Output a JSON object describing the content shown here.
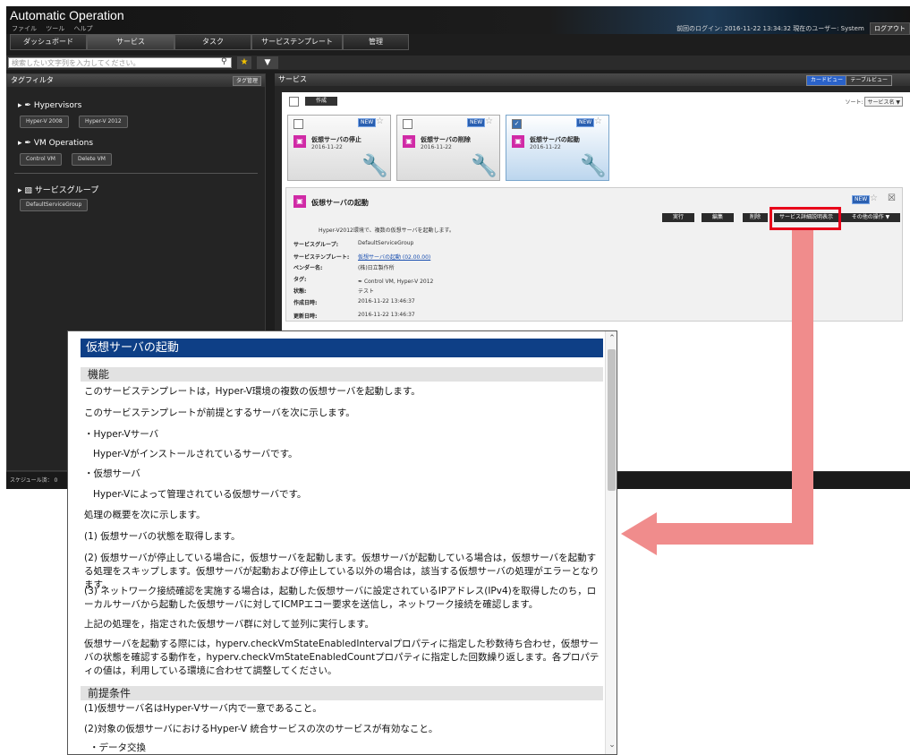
{
  "app": {
    "title": "Automatic Operation",
    "menu": [
      "ファイル",
      "ツール",
      "ヘルプ"
    ],
    "login_info": "前回のログイン: 2016-11-22 13:34:32  現在のユーザー: System",
    "logout_label": "ログアウト"
  },
  "tabs": [
    "ダッシュボード",
    "サービス",
    "タスク",
    "サービステンプレート",
    "管理"
  ],
  "search": {
    "placeholder": "検索したい文字列を入力してください。"
  },
  "left_panel": {
    "title": "タグフィルタ",
    "tag_manage_label": "タグ管理",
    "groups": [
      {
        "name": "Hypervisors",
        "tags": [
          "Hyper-V 2008",
          "Hyper-V 2012"
        ]
      },
      {
        "name": "VM Operations",
        "tags": [
          "Control VM",
          "Delete VM"
        ]
      }
    ],
    "service_group": {
      "name": "サービスグループ",
      "items": [
        "DefaultServiceGroup"
      ]
    }
  },
  "status_bar": {
    "text": "スケジュール済： 0"
  },
  "right_panel": {
    "title": "サービス",
    "card_view_label": "カードビュー",
    "table_view_label": "テーブルビュー",
    "create_label": "作成",
    "sort_label": "ソート:",
    "sort_value": "サービス名",
    "cards": [
      {
        "name": "仮想サーバの停止",
        "date": "2016-11-22",
        "badge": "NEW",
        "selected": false
      },
      {
        "name": "仮想サーバの削除",
        "date": "2016-11-22",
        "badge": "NEW",
        "selected": false
      },
      {
        "name": "仮想サーバの起動",
        "date": "2016-11-22",
        "badge": "NEW",
        "selected": true
      }
    ]
  },
  "detail": {
    "title": "仮想サーバの起動",
    "badge": "NEW",
    "actions": [
      "実行",
      "編集",
      "削除",
      "サービス詳細説明表示",
      "その他の操作"
    ],
    "description": "Hyper-V2012環境で、複数の仮想サーバを起動します。",
    "props": [
      {
        "label": "サービスグループ:",
        "value": "DefaultServiceGroup"
      },
      {
        "label": "サービステンプレート:",
        "value": "仮想サーバの起動 (02.00.00)"
      },
      {
        "label": "ベンダー名:",
        "value": "(株)日立製作所"
      },
      {
        "label": "タグ:",
        "value": "Control VM, Hyper-V 2012"
      },
      {
        "label": "状態:",
        "value": "テスト"
      },
      {
        "label": "作成日時:",
        "value": "2016-11-22 13:46:37"
      },
      {
        "label": "更新日時:",
        "value": "2016-11-22 13:46:37"
      }
    ]
  },
  "popup": {
    "title": "仮想サーバの起動",
    "section_function": "機能",
    "section_prereq": "前提条件",
    "lines": [
      "このサービステンプレートは，Hyper-V環境の複数の仮想サーバを起動します。",
      "このサービステンプレートが前提とするサーバを次に示します。",
      "・Hyper-Vサーバ",
      "Hyper-Vがインストールされているサーバです。",
      "・仮想サーバ",
      "Hyper-Vによって管理されている仮想サーバです。",
      "処理の概要を次に示します。",
      "(1) 仮想サーバの状態を取得します。",
      "(2) 仮想サーバが停止している場合に，仮想サーバを起動します。仮想サーバが起動している場合は，仮想サーバを起動する処理をスキップします。仮想サーバが起動および停止している以外の場合は，該当する仮想サーバの処理がエラーとなります。",
      "(3) ネットワーク接続確認を実施する場合は，起動した仮想サーバに設定されているIPアドレス(IPv4)を取得したのち，ローカルサーバから起動した仮想サーバに対してICMPエコー要求を送信し，ネットワーク接続を確認します。",
      "上記の処理を，指定された仮想サーバ群に対して並列に実行します。",
      "仮想サーバを起動する際には，hyperv.checkVmStateEnabledIntervalプロパティに指定した秒数待ち合わせ，仮想サーバの状態を確認する動作を，hyperv.checkVmStateEnabledCountプロパティに指定した回数繰り返します。各プロパティの値は，利用している環境に合わせて調整してください。"
    ],
    "prereq_lines": [
      "(1)仮想サーバ名はHyper-Vサーバ内で一意であること。",
      "(2)対象の仮想サーバにおけるHyper-V 統合サービスの次のサービスが有効なこと。",
      "・データ交換"
    ]
  }
}
